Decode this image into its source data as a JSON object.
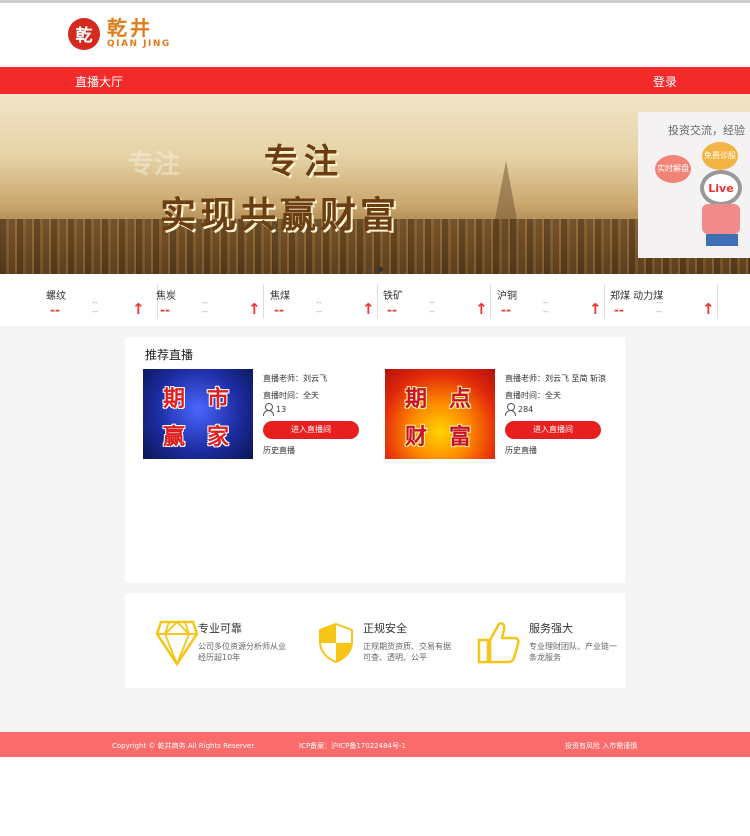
{
  "logo": {
    "mark": "乾",
    "name_cn": "乾井",
    "name_en": "QIAN JING"
  },
  "nav": {
    "live_hall": "直播大厅",
    "login": "登录"
  },
  "banner": {
    "ghost_text": "专注",
    "line1": "专注",
    "line2": "实现共赢财富",
    "right_text": "投资交流，经验",
    "bubble_a": "实时解盘",
    "bubble_b": "免费诊股",
    "live_badge": "Live"
  },
  "ticker": [
    {
      "name": "螺纹",
      "price": "--",
      "change": "--",
      "change2": "--",
      "arrow": "↑"
    },
    {
      "name": "焦炭",
      "price": "--",
      "change": "--",
      "change2": "--",
      "arrow": "↑"
    },
    {
      "name": "焦煤",
      "price": "--",
      "change": "--",
      "change2": "--",
      "arrow": "↑"
    },
    {
      "name": "铁矿",
      "price": "--",
      "change": "--",
      "change2": "--",
      "arrow": "↑"
    },
    {
      "name": "沪铜",
      "price": "--",
      "change": "--",
      "change2": "--",
      "arrow": "↑"
    },
    {
      "name": "郑煤 动力煤",
      "price": "--",
      "change": "--",
      "change2": "--",
      "arrow": "↑"
    }
  ],
  "live": {
    "title": "推荐直播",
    "cards": [
      {
        "thumb_chars": [
          "期",
          "市",
          "赢",
          "家"
        ],
        "teacher": "直播老师：刘云飞",
        "time": "直播时间：全天",
        "viewers": "13",
        "enter": "进入直播间",
        "history": "历史直播"
      },
      {
        "thumb_chars": [
          "期",
          "点",
          "财",
          "富"
        ],
        "teacher": "直播老师：刘云飞 至简 斩浪",
        "time": "直播时间：全天",
        "viewers": "284",
        "enter": "进入直播间",
        "history": "历史直播"
      }
    ]
  },
  "features": [
    {
      "title": "专业可靠",
      "desc": "公司多位资源分析师从业经历超10年",
      "icon": "diamond-icon"
    },
    {
      "title": "正规安全",
      "desc": "正规期货资质、交易有据可查、透明、公平",
      "icon": "shield-icon"
    },
    {
      "title": "服务强大",
      "desc": "专业理财团队、产业链一条龙服务",
      "icon": "thumbs-up-icon"
    }
  ],
  "footer": {
    "copyright": "Copyright © 乾井商务 All Rights Reserver.",
    "icp": "ICP备案：沪ICP备17022484号-1",
    "risk": "投资有风险 入市需谨慎"
  },
  "colors": {
    "brand_red": "#f22a2a",
    "footer_red": "#fb6b6b",
    "logo_orange": "#e07b1a",
    "icon_yellow": "#f5c518"
  }
}
